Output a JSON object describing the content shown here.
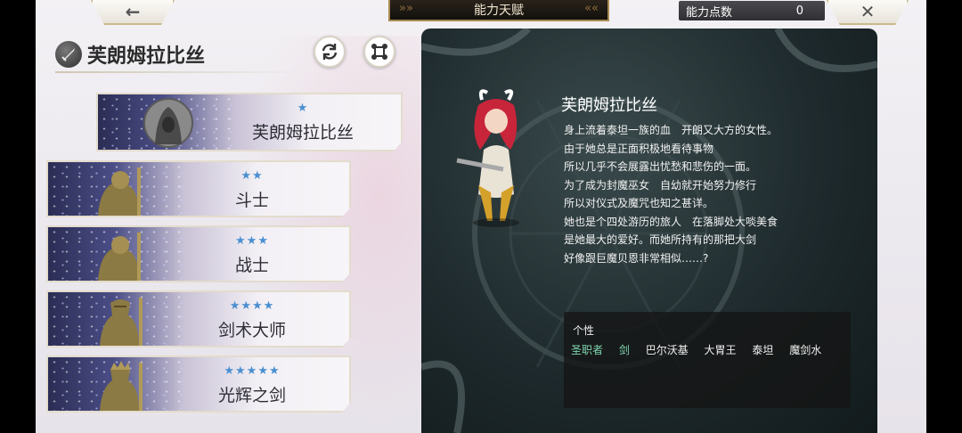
{
  "topbar": {
    "back_label": "←",
    "title": "能力天赋",
    "points_label": "能力点数",
    "points_value": "0",
    "close_label": "✕"
  },
  "character": {
    "name": "芙朗姆拉比丝"
  },
  "class_list": [
    {
      "stars": "★",
      "name": "芙朗姆拉比丝",
      "state": "selected",
      "portrait": "hooded-silhouette-icon"
    },
    {
      "stars": "★★",
      "name": "斗士",
      "state": "normal",
      "portrait": "armored-warrior-icon"
    },
    {
      "stars": "★★★",
      "name": "战士",
      "state": "normal",
      "portrait": "armored-warrior-icon"
    },
    {
      "stars": "★★★★",
      "name": "剑术大师",
      "state": "normal",
      "portrait": "helmed-knight-icon"
    },
    {
      "stars": "★★★★★",
      "name": "光辉之剑",
      "state": "normal",
      "portrait": "crowned-knight-icon"
    }
  ],
  "detail": {
    "name": "芙朗姆拉比丝",
    "description": [
      "身上流着泰坦一族的血　开朗又大方的女性。",
      "由于她总是正面积极地看待事物",
      "所以几乎不会展露出忧愁和悲伤的一面。",
      "为了成为封魔巫女　自幼就开始努力修行",
      "所以对仪式及魔咒也知之甚详。",
      "她也是个四处游历的旅人　在落脚处大啖美食",
      "是她最大的爱好。而她所持有的那把大剑",
      "好像跟巨魔贝恩非常相似……?"
    ],
    "traits_label": "个性",
    "traits": [
      {
        "text": "圣职者",
        "highlight": true
      },
      {
        "text": "剑",
        "highlight": true
      },
      {
        "text": "巴尔沃基",
        "highlight": false
      },
      {
        "text": "大胃王",
        "highlight": false
      },
      {
        "text": "泰坦",
        "highlight": false
      },
      {
        "text": "魔剑水",
        "highlight": false
      }
    ]
  },
  "colors": {
    "star": "#4a8fd0",
    "trait_highlight": "#7fd6b0",
    "title_plate": "#12100d"
  }
}
